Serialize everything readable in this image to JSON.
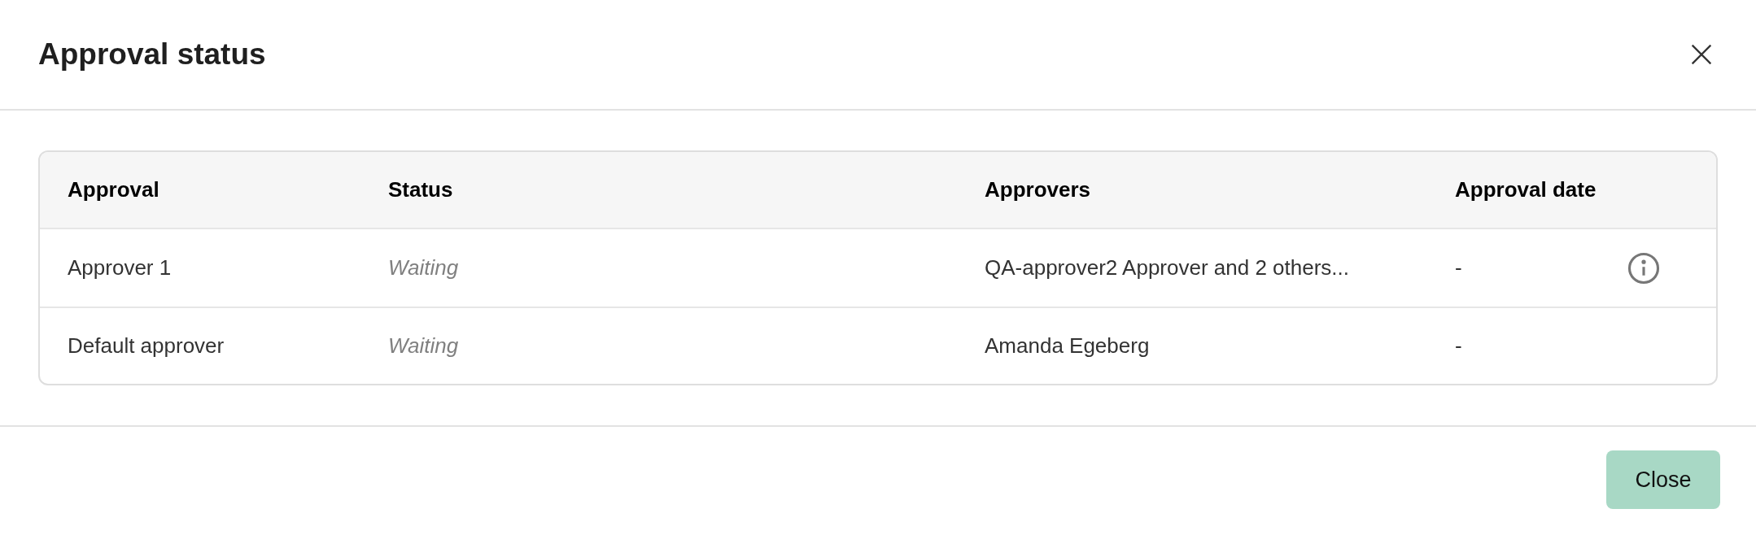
{
  "dialog": {
    "title": "Approval status"
  },
  "table": {
    "columns": [
      "Approval",
      "Status",
      "Approvers",
      "Approval date"
    ],
    "rows": [
      {
        "approval": "Approver 1",
        "status": "Waiting",
        "approvers": "QA-approver2 Approver and 2 others...",
        "approval_date": "-",
        "info": true
      },
      {
        "approval": "Default approver",
        "status": "Waiting",
        "approvers": "Amanda Egeberg",
        "approval_date": "-",
        "info": false
      }
    ]
  },
  "buttons": [
    "Close"
  ]
}
